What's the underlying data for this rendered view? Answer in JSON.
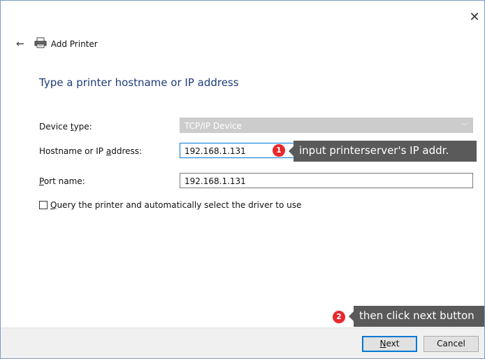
{
  "window": {
    "close_icon": "close-icon"
  },
  "header": {
    "back_icon": "back-arrow-icon",
    "printer_icon": "printer-icon",
    "title": "Add Printer"
  },
  "page_title": "Type a printer hostname or IP address",
  "form": {
    "device_type": {
      "label_pre": "Device ",
      "label_key": "t",
      "label_post": "ype:",
      "value": "TCP/IP Device"
    },
    "hostname": {
      "label_pre": "Hostname or IP ",
      "label_key": "a",
      "label_post": "ddress:",
      "value": "192.168.1.131"
    },
    "port": {
      "label_pre": "",
      "label_key": "P",
      "label_post": "ort name:",
      "value": "192.168.1.131"
    },
    "query": {
      "label_pre": "",
      "label_key": "Q",
      "label_post": "uery the printer and automatically select the driver to use",
      "checked": false
    }
  },
  "annotations": [
    {
      "number": "1",
      "text": "input printerserver's IP addr.",
      "color": "#e8282c"
    },
    {
      "number": "2",
      "text": "then click next button",
      "color": "#e8282c"
    }
  ],
  "footer": {
    "next_pre": "",
    "next_key": "N",
    "next_post": "ext",
    "cancel_label": "Cancel"
  }
}
